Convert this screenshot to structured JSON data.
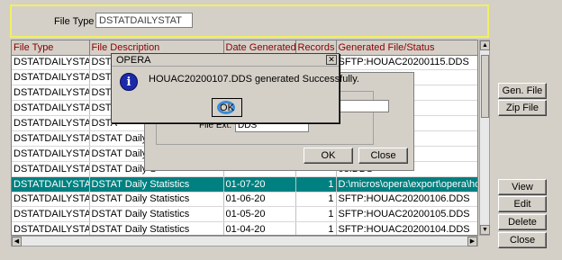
{
  "filter": {
    "label": "File Type",
    "value": "DSTATDAILYSTAT"
  },
  "table": {
    "columns": [
      "File Type",
      "File Description",
      "Date Generated",
      "Records",
      "Generated File/Status"
    ],
    "rows": [
      [
        "DSTATDAILYSTAT",
        "DSTA",
        "",
        "",
        "SFTP:HOUAC20200115.DDS"
      ],
      [
        "DSTATDAILYSTAT",
        "DSTA",
        "",
        "",
        "rt\\opera\\houa"
      ],
      [
        "DSTATDAILYSTAT",
        "DSTA",
        "",
        "",
        "13.DDS"
      ],
      [
        "DSTATDAILYSTAT",
        "DSTA",
        "",
        "",
        "12.DDS"
      ],
      [
        "DSTATDAILYSTAT",
        "DSTA",
        "",
        "",
        "11.DDS"
      ],
      [
        "DSTATDAILYSTAT",
        "DSTAT Daily S",
        "",
        "",
        "10.DDS"
      ],
      [
        "DSTATDAILYSTAT",
        "DSTAT Daily S",
        "",
        "",
        "09.DDS"
      ],
      [
        "DSTATDAILYSTAT",
        "DSTAT Daily S",
        "",
        "",
        "08.DDS"
      ],
      [
        "DSTATDAILYSTAT",
        "DSTAT Daily Statistics",
        "01-07-20",
        "1",
        "D:\\micros\\opera\\export\\opera\\houa"
      ],
      [
        "DSTATDAILYSTAT",
        "DSTAT Daily Statistics",
        "01-06-20",
        "1",
        "SFTP:HOUAC20200106.DDS"
      ],
      [
        "DSTATDAILYSTAT",
        "DSTAT Daily Statistics",
        "01-05-20",
        "1",
        "SFTP:HOUAC20200105.DDS"
      ],
      [
        "DSTATDAILYSTAT",
        "DSTAT Daily Statistics",
        "01-04-20",
        "1",
        "SFTP:HOUAC20200104.DDS"
      ]
    ]
  },
  "side_buttons": {
    "gen_file": "Gen. File",
    "zip_file": "Zip File",
    "view": "View",
    "edit": "Edit",
    "delete": "Delete",
    "close": "Close"
  },
  "background_dialog": {
    "field_label": "File Ext.",
    "field_value": "DDS",
    "ok": "OK",
    "close": "Close"
  },
  "message_box": {
    "title": "OPERA",
    "close_glyph": "✕",
    "icon": "info-icon",
    "message": "HOUAC20200107.DDS generated Successfully.",
    "ok": "OK"
  },
  "colors": {
    "selection": "#008080",
    "header_text": "#8b0000",
    "filter_border": "#f0f060"
  }
}
